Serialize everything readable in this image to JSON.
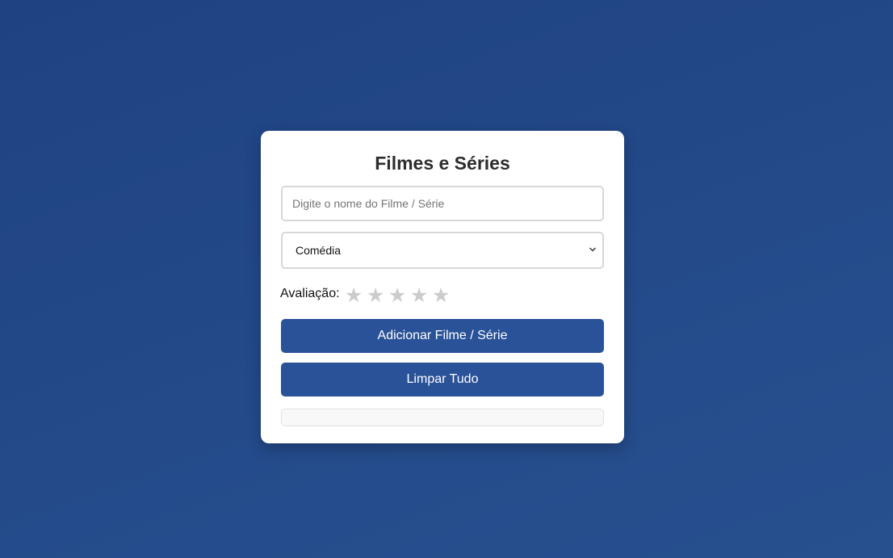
{
  "app": {
    "title": "Filmes e Séries"
  },
  "form": {
    "name_placeholder": "Digite o nome do Filme / Série",
    "name_value": "",
    "genre": {
      "selected": "Comédia",
      "options": [
        "Comédia"
      ]
    },
    "rating": {
      "label": "Avaliação:",
      "max": 5,
      "value": 0,
      "star_glyph": "★",
      "star_color": "#cccccc"
    },
    "add_label": "Adicionar Filme / Série",
    "clear_label": "Limpar Tudo"
  },
  "list": {
    "items": []
  },
  "colors": {
    "accent": "#2a5298",
    "background": "#234886",
    "card": "#ffffff"
  }
}
